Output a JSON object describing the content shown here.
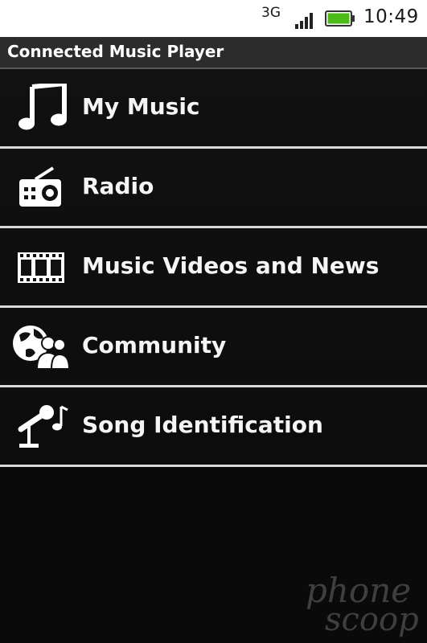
{
  "status_bar": {
    "network": "3G",
    "time": "10:49",
    "signal_icon": "signal-bars-icon",
    "battery_icon": "battery-icon",
    "battery_color": "#4cbb17"
  },
  "app": {
    "title": "Connected Music Player"
  },
  "menu": {
    "items": [
      {
        "label": "My Music",
        "icon": "music-note-icon"
      },
      {
        "label": "Radio",
        "icon": "radio-icon"
      },
      {
        "label": "Music Videos and News",
        "icon": "film-strip-icon"
      },
      {
        "label": "Community",
        "icon": "globe-people-icon"
      },
      {
        "label": "Song Identification",
        "icon": "microphone-note-icon"
      }
    ]
  },
  "watermark": {
    "line1": "phone",
    "line2": "scoop"
  }
}
